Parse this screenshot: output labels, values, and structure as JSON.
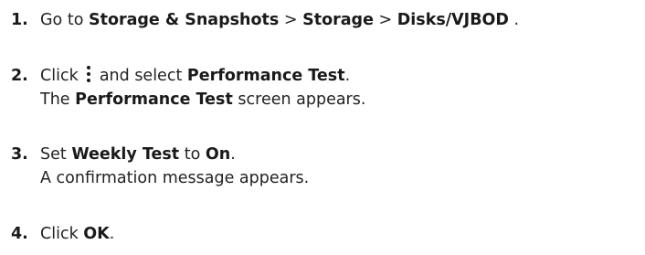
{
  "steps": [
    {
      "number": "1.",
      "line1": {
        "t1": "Go to ",
        "b1": "Storage & Snapshots",
        "t2": " > ",
        "b2": "Storage",
        "t3": " > ",
        "b3": "Disks/VJBOD",
        "t4": " ."
      }
    },
    {
      "number": "2.",
      "line1": {
        "t1": "Click ",
        "icon": "kebab-menu-icon",
        "t2": " and select ",
        "b1": "Performance Test",
        "t3": "."
      },
      "line2": {
        "t1": "The ",
        "b1": "Performance Test",
        "t2": " screen appears."
      }
    },
    {
      "number": "3.",
      "line1": {
        "t1": "Set ",
        "b1": "Weekly Test",
        "t2": " to ",
        "b2": "On",
        "t3": "."
      },
      "line2": {
        "t1": "A confirmation message appears."
      }
    },
    {
      "number": "4.",
      "line1": {
        "t1": "Click ",
        "b1": "OK",
        "t2": "."
      }
    }
  ]
}
